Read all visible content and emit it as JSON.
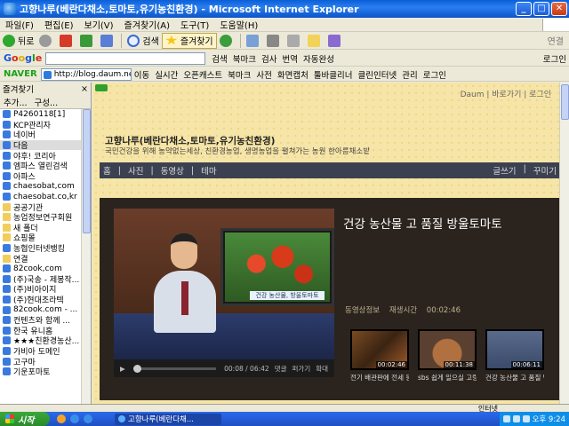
{
  "window": {
    "title": "고향나루(베란다채소,토마토,유기농친환경) - Microsoft Internet Explorer",
    "minimize": "_",
    "maximize": "□",
    "close": "✕"
  },
  "menu": [
    "파일(F)",
    "편집(E)",
    "보기(V)",
    "즐겨찾기(A)",
    "도구(T)",
    "도움말(H)"
  ],
  "toolbar": {
    "back": "뒤로",
    "search": "검색",
    "favorites": "즐겨찾기",
    "links": "연결"
  },
  "google_bar": {
    "logo": [
      "G",
      "o",
      "o",
      "g",
      "l",
      "e"
    ],
    "search_btn": "검색",
    "items": [
      "북마크",
      "검사",
      "번역",
      "자동완성",
      "로그인"
    ]
  },
  "naver_bar": {
    "logo": "NAVER",
    "address": "http://blog.daum.net/ch51",
    "items": [
      "이동",
      "실시간",
      "오픈캐스트",
      "북마크",
      "사전",
      "화면캡처",
      "툴바클리너",
      "클린인터넷",
      "관리",
      "로그인"
    ]
  },
  "favorites": {
    "header": "즐겨찾기",
    "close": "×",
    "add": "추가...",
    "organize": "구성...",
    "items": [
      {
        "label": "P4260118[1]",
        "type": "link"
      },
      {
        "label": "KCP관리자",
        "type": "link"
      },
      {
        "label": "네이버",
        "type": "link"
      },
      {
        "label": "다음",
        "type": "link",
        "selected": true
      },
      {
        "label": "야후! 코리아",
        "type": "link"
      },
      {
        "label": "엠파스 열린검색",
        "type": "link"
      },
      {
        "label": "아파스",
        "type": "link"
      },
      {
        "label": "chaesobat,com",
        "type": "link"
      },
      {
        "label": "chaesobat.co,kr",
        "type": "link"
      },
      {
        "label": "공공기관",
        "type": "folder"
      },
      {
        "label": "농업정보연구회원",
        "type": "folder"
      },
      {
        "label": "새 폴더",
        "type": "folder"
      },
      {
        "label": "쇼핑몰",
        "type": "folder"
      },
      {
        "label": "농협인터넷뱅킹",
        "type": "link"
      },
      {
        "label": "연결",
        "type": "folder"
      },
      {
        "label": "82cook,com",
        "type": "link"
      },
      {
        "label": "(주)국송 - 제봉작...",
        "type": "link"
      },
      {
        "label": "(주)비아이지",
        "type": "link"
      },
      {
        "label": "(주)현대조라텍",
        "type": "link"
      },
      {
        "label": "82cook.com - ...",
        "type": "link"
      },
      {
        "label": "컨텐츠와 함께 ...",
        "type": "link"
      },
      {
        "label": "한국 유니홈",
        "type": "link"
      },
      {
        "label": "★★★친환경농산...",
        "type": "link"
      },
      {
        "label": "가비아 도메인",
        "type": "link"
      },
      {
        "label": "고구마",
        "type": "link"
      },
      {
        "label": "기운포마토",
        "type": "link"
      }
    ]
  },
  "blog": {
    "top_links": "Daum | 바로가기 | 로그인",
    "title": "고향나루(베란다채소,토마토,유기농친환경)",
    "description": "국민건강을 위해 농약없는세상, 친환경농업, 생명농업을 펼쳐가는 농원 한아름채소밭",
    "nav": [
      "홈",
      "|",
      "사진",
      "|",
      "동영상",
      "|",
      "테마"
    ],
    "nav_right": [
      "글쓰기",
      "|",
      "꾸미기"
    ],
    "post_title": "건강 농산물 고 품질 방울토마토",
    "video": {
      "tv_caption": "건강 농산물, 방울토마토",
      "time": "00:08 / 06:42",
      "controls": [
        "댓글",
        "퍼가기",
        "확대"
      ]
    },
    "video_info": [
      "동영상정보",
      "재생시간",
      "00:02:46"
    ],
    "thumbs": [
      {
        "caption": "전기 배관판에 전세 등",
        "duration": "00:02:46"
      },
      {
        "caption": "sbs 쉽게 일으실 고량",
        "duration": "00:11:38"
      },
      {
        "caption": "건강 농산물 고 품질 방",
        "duration": "00:06:11"
      }
    ]
  },
  "status": {
    "zone": "인터넷"
  },
  "taskbar": {
    "start": "시작",
    "task": "고향나루(베란다채...",
    "clock": "오후 9:24"
  }
}
